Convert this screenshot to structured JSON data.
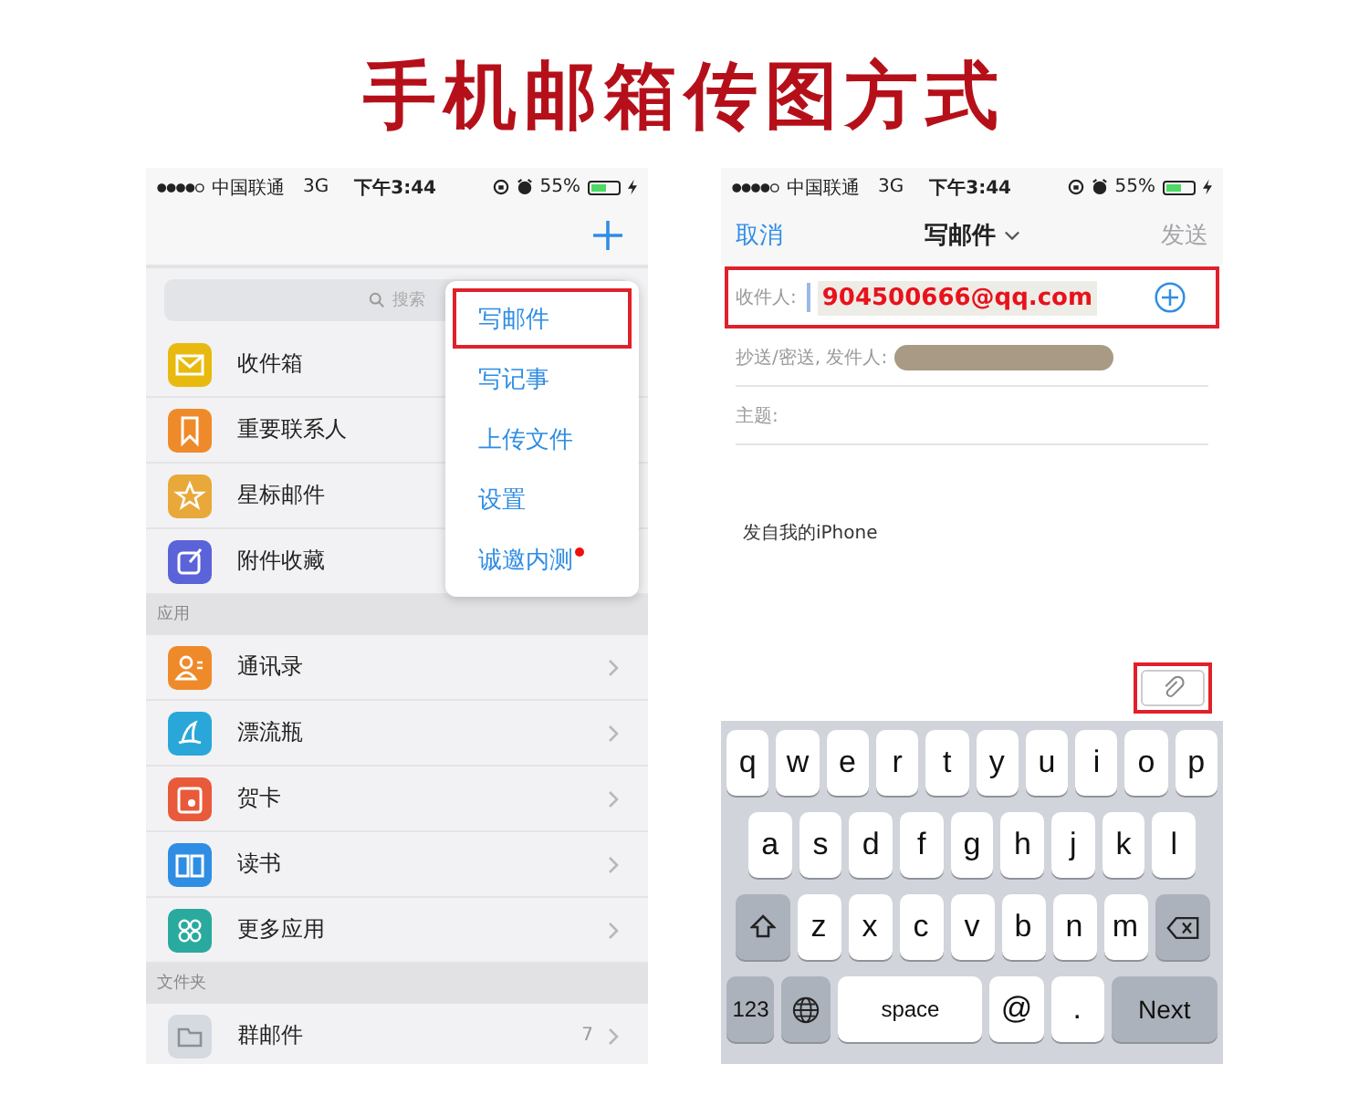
{
  "title": "手机邮箱传图方式",
  "left_phone": {
    "status_bar": {
      "carrier": "中国联通",
      "network": "3G",
      "time": "下午3:44",
      "battery": "55%"
    },
    "search": {
      "placeholder": "搜索"
    },
    "mail_items": [
      {
        "label": "收件箱",
        "color": "#e8b90f"
      },
      {
        "label": "重要联系人",
        "color": "#ef8a2b"
      },
      {
        "label": "星标邮件",
        "color": "#e9a83a"
      },
      {
        "label": "附件收藏",
        "color": "#5b63d9"
      }
    ],
    "sections": [
      {
        "header": "应用",
        "items": [
          {
            "label": "通讯录",
            "color": "#ef8a2b"
          },
          {
            "label": "漂流瓶",
            "color": "#2aa7d9"
          },
          {
            "label": "贺卡",
            "color": "#e85a3a"
          },
          {
            "label": "读书",
            "color": "#2f8de4"
          },
          {
            "label": "更多应用",
            "color": "#2aaa9e"
          }
        ]
      },
      {
        "header": "文件夹",
        "items": [
          {
            "label": "群邮件",
            "color": "#d5d9e0",
            "count": "7"
          }
        ]
      }
    ],
    "popup_menu": [
      {
        "label": "写邮件",
        "highlighted": true,
        "new_dot": false
      },
      {
        "label": "写记事",
        "highlighted": false,
        "new_dot": false
      },
      {
        "label": "上传文件",
        "highlighted": false,
        "new_dot": false
      },
      {
        "label": "设置",
        "highlighted": false,
        "new_dot": false
      },
      {
        "label": "诚邀内测",
        "highlighted": false,
        "new_dot": true
      }
    ]
  },
  "right_phone": {
    "status_bar": {
      "carrier": "中国联通",
      "network": "3G",
      "time": "下午3:44",
      "battery": "55%"
    },
    "nav": {
      "cancel": "取消",
      "title": "写邮件",
      "send": {
        "label": "发送",
        "disabled": true
      }
    },
    "to_field": {
      "label": "收件人:",
      "value": "904500666@qq.com",
      "highlighted": true
    },
    "cc_field": {
      "label": "抄送/密送, 发件人:",
      "redacted": true
    },
    "subject_field": {
      "label": "主题:"
    },
    "signature": "发自我的iPhone",
    "attach_button": {
      "highlighted": true
    },
    "keyboard": [
      [
        {
          "kind": "letter",
          "label": "q"
        },
        {
          "kind": "letter",
          "label": "w"
        },
        {
          "kind": "letter",
          "label": "e"
        },
        {
          "kind": "letter",
          "label": "r"
        },
        {
          "kind": "letter",
          "label": "t"
        },
        {
          "kind": "letter",
          "label": "y"
        },
        {
          "kind": "letter",
          "label": "u"
        },
        {
          "kind": "letter",
          "label": "i"
        },
        {
          "kind": "letter",
          "label": "o"
        },
        {
          "kind": "letter",
          "label": "p"
        }
      ],
      [
        {
          "kind": "letter",
          "label": "a"
        },
        {
          "kind": "letter",
          "label": "s"
        },
        {
          "kind": "letter",
          "label": "d"
        },
        {
          "kind": "letter",
          "label": "f"
        },
        {
          "kind": "letter",
          "label": "g"
        },
        {
          "kind": "letter",
          "label": "h"
        },
        {
          "kind": "letter",
          "label": "j"
        },
        {
          "kind": "letter",
          "label": "k"
        },
        {
          "kind": "letter",
          "label": "l"
        }
      ],
      [
        {
          "kind": "shift"
        },
        {
          "kind": "letter",
          "label": "z"
        },
        {
          "kind": "letter",
          "label": "x"
        },
        {
          "kind": "letter",
          "label": "c"
        },
        {
          "kind": "letter",
          "label": "v"
        },
        {
          "kind": "letter",
          "label": "b"
        },
        {
          "kind": "letter",
          "label": "n"
        },
        {
          "kind": "letter",
          "label": "m"
        },
        {
          "kind": "delete"
        }
      ],
      [
        {
          "kind": "function",
          "label": "123"
        },
        {
          "kind": "globe"
        },
        {
          "kind": "space",
          "label": "space"
        },
        {
          "kind": "letter",
          "label": "@"
        },
        {
          "kind": "letter",
          "label": "."
        },
        {
          "kind": "function",
          "label": "Next"
        }
      ]
    ]
  }
}
